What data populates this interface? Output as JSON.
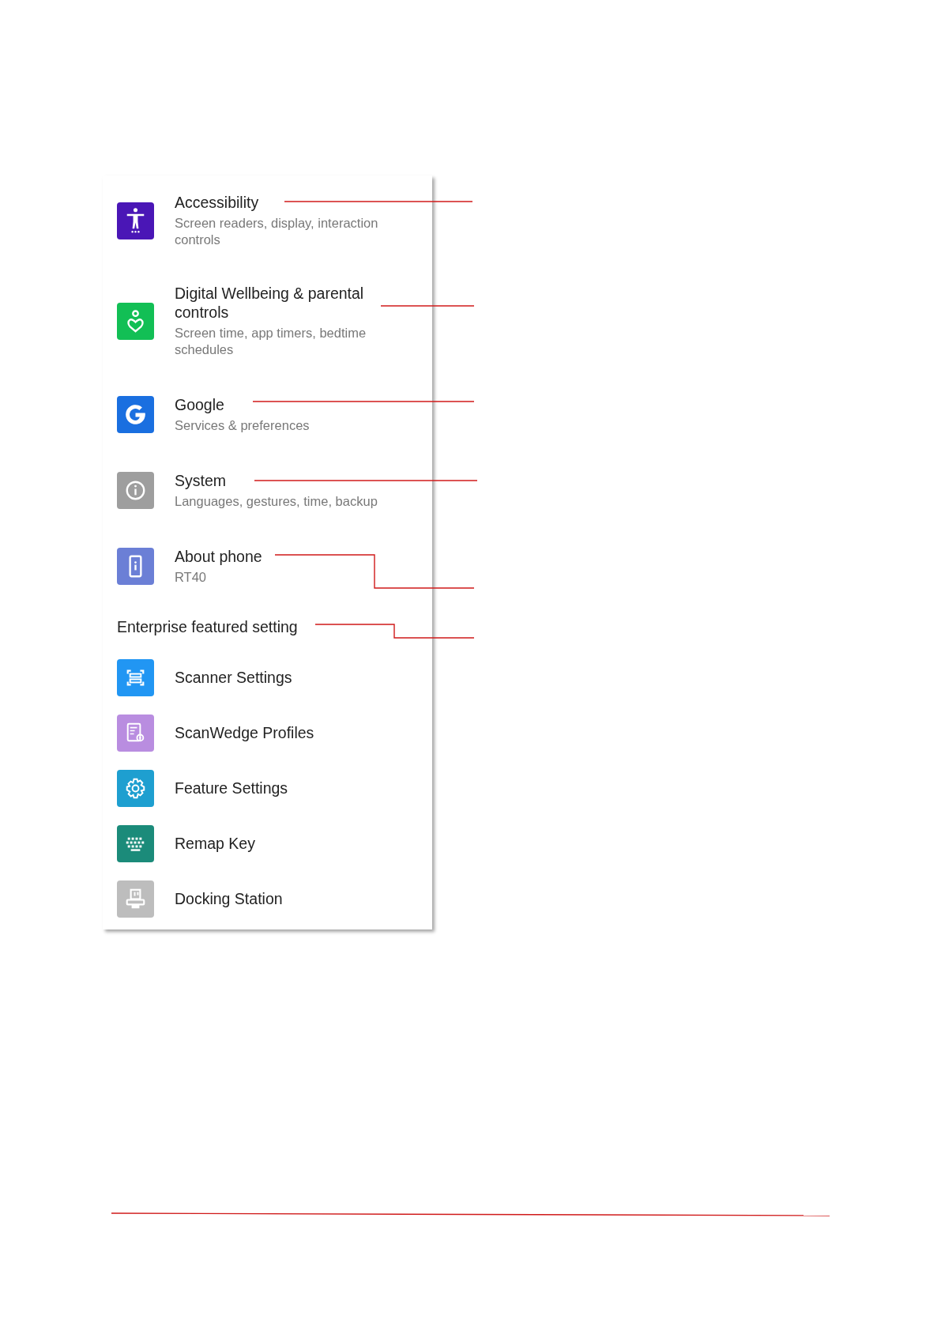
{
  "settings": [
    {
      "title": "Accessibility",
      "subtitle": "Screen readers, display, interaction controls",
      "color": "#4a16b6"
    },
    {
      "title": "Digital Wellbeing & parental controls",
      "subtitle": "Screen time, app timers, bedtime schedules",
      "color": "#12bf55"
    },
    {
      "title": "Google",
      "subtitle": "Services & preferences",
      "color": "#1a6fe0"
    },
    {
      "title": "System",
      "subtitle": "Languages, gestures, time, backup",
      "color": "#9e9e9e"
    },
    {
      "title": "About phone",
      "subtitle": "RT40",
      "color": "#6b7fd6"
    }
  ],
  "section_header": "Enterprise featured setting",
  "enterprise_items": [
    {
      "title": "Scanner Settings",
      "color": "#2196f3"
    },
    {
      "title": "ScanWedge Profiles",
      "color": "#b98de0"
    },
    {
      "title": "Feature Settings",
      "color": "#1e9fd0"
    },
    {
      "title": "Remap Key",
      "color": "#1b8b7a"
    },
    {
      "title": "Docking Station",
      "color": "#bdbdbd"
    }
  ]
}
